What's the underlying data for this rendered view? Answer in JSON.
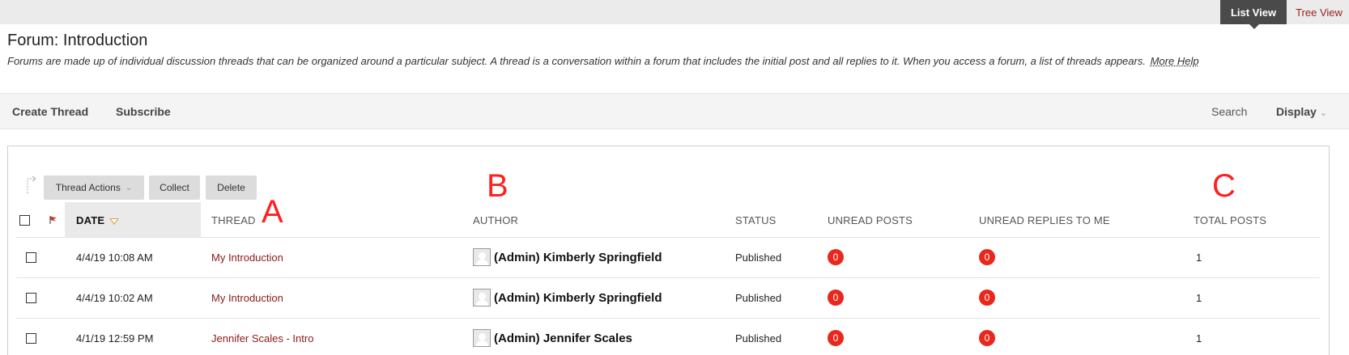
{
  "top_tabs": {
    "list_view": "List View",
    "tree_view": "Tree View"
  },
  "page": {
    "title": "Forum: Introduction",
    "description": "Forums are made up of individual discussion threads that can be organized around a particular subject. A thread is a conversation within a forum that includes the initial post and all replies to it. When you access a forum, a list of threads appears.",
    "more_help": "More Help"
  },
  "action_bar": {
    "create_thread": "Create Thread",
    "subscribe": "Subscribe",
    "search": "Search",
    "display": "Display"
  },
  "table_actions": {
    "thread_actions": "Thread Actions",
    "collect": "Collect",
    "delete": "Delete"
  },
  "annotations": {
    "a": "A",
    "b": "B",
    "c": "C"
  },
  "columns": {
    "date": "DATE",
    "thread": "THREAD",
    "author": "AUTHOR",
    "status": "STATUS",
    "unread_posts": "UNREAD POSTS",
    "unread_replies": "UNREAD REPLIES TO ME",
    "total_posts": "TOTAL POSTS"
  },
  "rows": [
    {
      "date": "4/4/19 10:08 AM",
      "thread": "My Introduction",
      "author": "(Admin) Kimberly Springfield",
      "status": "Published",
      "unread_posts": "0",
      "unread_replies": "0",
      "total_posts": "1"
    },
    {
      "date": "4/4/19 10:02 AM",
      "thread": "My Introduction",
      "author": "(Admin) Kimberly Springfield",
      "status": "Published",
      "unread_posts": "0",
      "unread_replies": "0",
      "total_posts": "1"
    },
    {
      "date": "4/1/19 12:59 PM",
      "thread": "Jennifer Scales - Intro",
      "author": "(Admin) Jennifer Scales",
      "status": "Published",
      "unread_posts": "0",
      "unread_replies": "0",
      "total_posts": "1"
    }
  ],
  "colors": {
    "accent_red": "#8b1a1a",
    "badge_red": "#e8271d",
    "annotation_red": "#ff2020"
  }
}
